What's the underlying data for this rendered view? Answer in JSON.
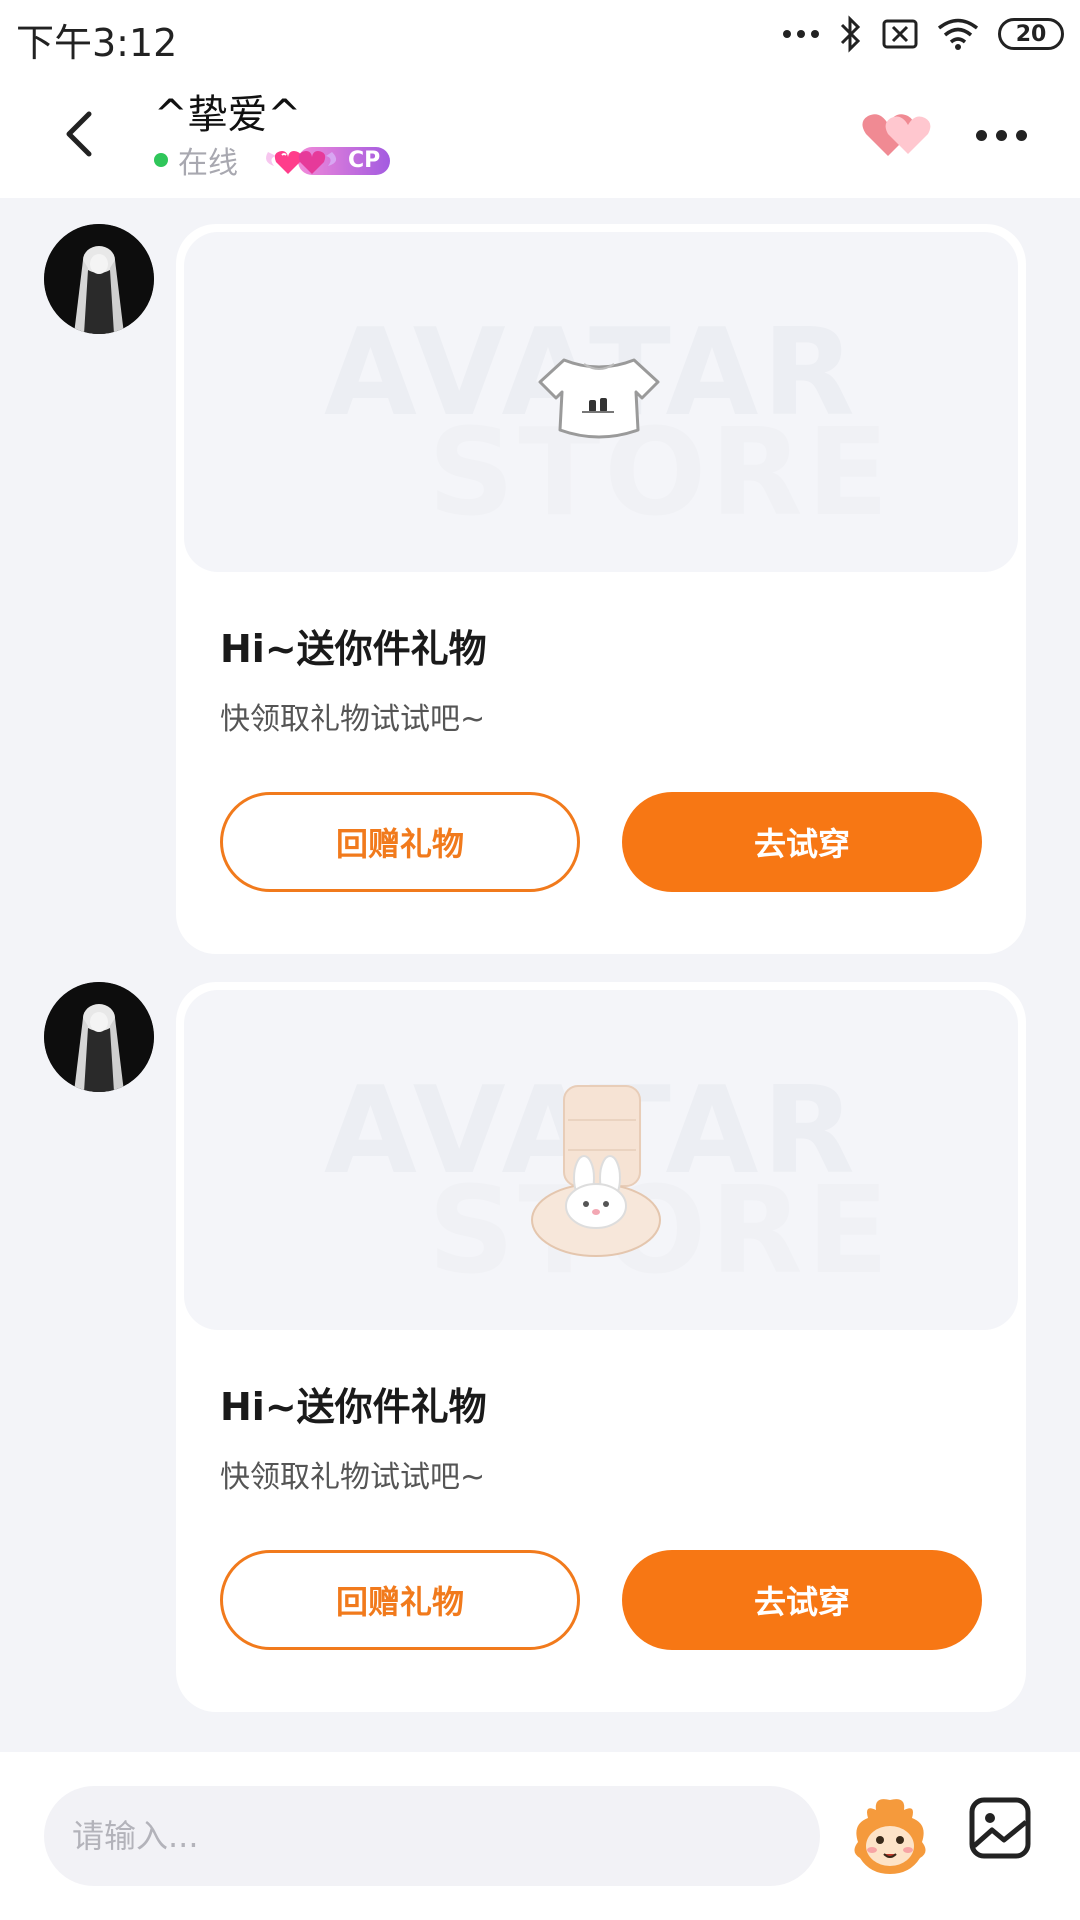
{
  "status_bar": {
    "time": "下午3:12",
    "battery": "20",
    "icons": [
      "more-dots-icon",
      "bluetooth-icon",
      "sim-off-icon",
      "wifi-icon",
      "battery-icon"
    ]
  },
  "header": {
    "title": "^挚爱^",
    "online_label": "在线",
    "cp_label": "CP",
    "icons": [
      "back-arrow-icon",
      "double-heart-icon",
      "more-icon"
    ]
  },
  "messages": [
    {
      "title": "Hi~送你件礼物",
      "subtitle": "快领取礼物试试吧~",
      "return_label": "回赠礼物",
      "try_label": "去试穿",
      "item_icon": "crop-top-shirt-icon"
    },
    {
      "title": "Hi~送你件礼物",
      "subtitle": "快领取礼物试试吧~",
      "return_label": "回赠礼物",
      "try_label": "去试穿",
      "item_icon": "bunny-boot-icon"
    }
  ],
  "input": {
    "placeholder": "请输入..."
  },
  "colors": {
    "accent": "#f77714",
    "online": "#2fc65a",
    "background": "#f3f4f8"
  }
}
